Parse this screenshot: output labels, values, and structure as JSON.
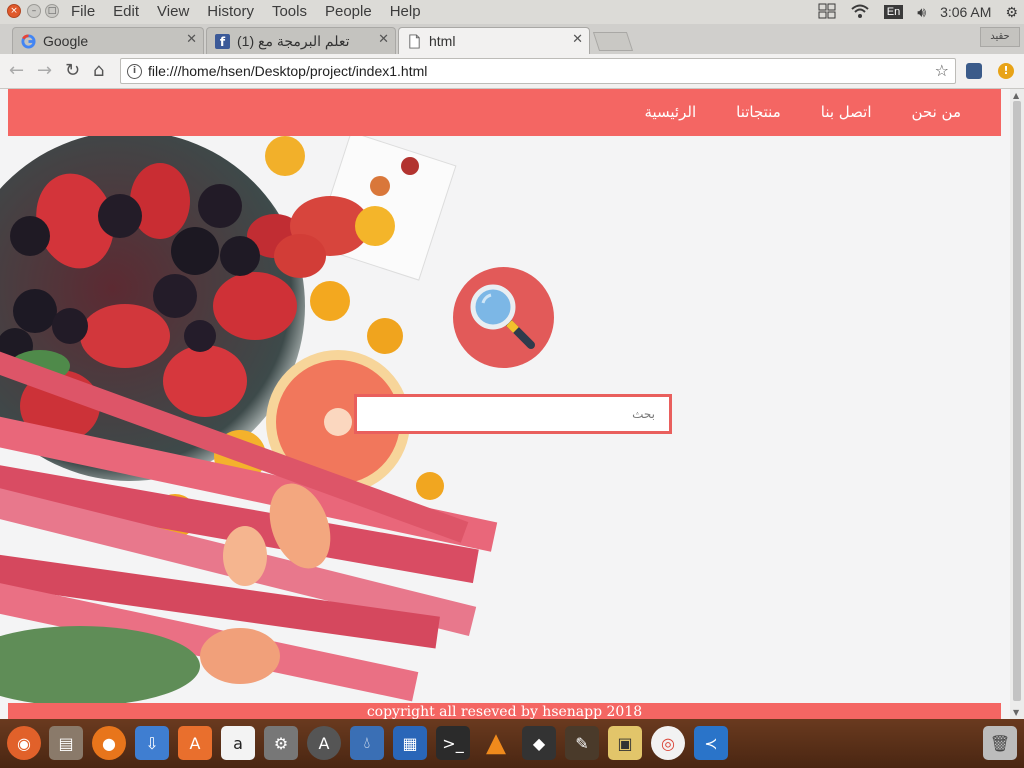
{
  "menubar": {
    "items": [
      "File",
      "Edit",
      "View",
      "History",
      "Tools",
      "People",
      "Help"
    ],
    "lang": "En",
    "time": "3:06 AM"
  },
  "tabs": [
    {
      "label": "Google",
      "favicon": "google-icon"
    },
    {
      "label": "(1) تعلم البرمجة مع",
      "favicon": "facebook-icon"
    },
    {
      "label": "html",
      "favicon": "document-icon"
    }
  ],
  "profile_label": "حقيد",
  "address_bar": {
    "url": "file:///home/hsen/Desktop/project/index1.html"
  },
  "page": {
    "nav": [
      "من نحن",
      "اتصل بنا",
      "منتجاتنا",
      "الرئيسية"
    ],
    "search_placeholder": "بحث",
    "footer": "copyright all reseved by hsenapp 2018"
  },
  "colors": {
    "accent": "#f46663",
    "search_circle": "#e25a59",
    "dock": "#5a2f18"
  },
  "dock_icons": [
    "ubuntu-icon",
    "files-icon",
    "firefox-icon",
    "transmission-icon",
    "software-center-icon",
    "amazon-icon",
    "settings-icon",
    "update-icon",
    "drop-icon",
    "writer-icon",
    "terminal-icon",
    "vlc-icon",
    "inkscape-icon",
    "paint-icon",
    "image-viewer-icon",
    "chrome-icon",
    "vscode-icon",
    "trash-icon"
  ]
}
